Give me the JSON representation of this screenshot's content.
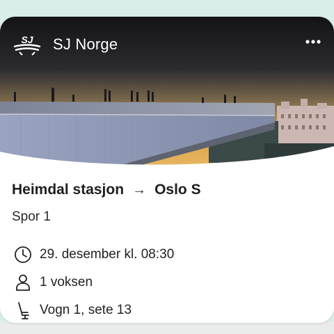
{
  "brand": {
    "name": "SJ Norge",
    "logo_text": "SJ",
    "logo_icon": "sj-logo-icon"
  },
  "menu": {
    "icon": "more-horizontal-icon"
  },
  "trip": {
    "from": "Heimdal stasjon",
    "arrow": "→",
    "to": "Oslo S",
    "platform": "Spor 1",
    "datetime": "29. desember kl. 08:30",
    "passengers": "1 voksen",
    "seat": "Vogn 1, sete 13"
  },
  "icons": {
    "time": "clock-icon",
    "passengers": "person-icon",
    "seat": "seat-icon"
  },
  "colors": {
    "background": "#d9eee9",
    "card": "#ffffff",
    "text": "#1f1f1f"
  }
}
